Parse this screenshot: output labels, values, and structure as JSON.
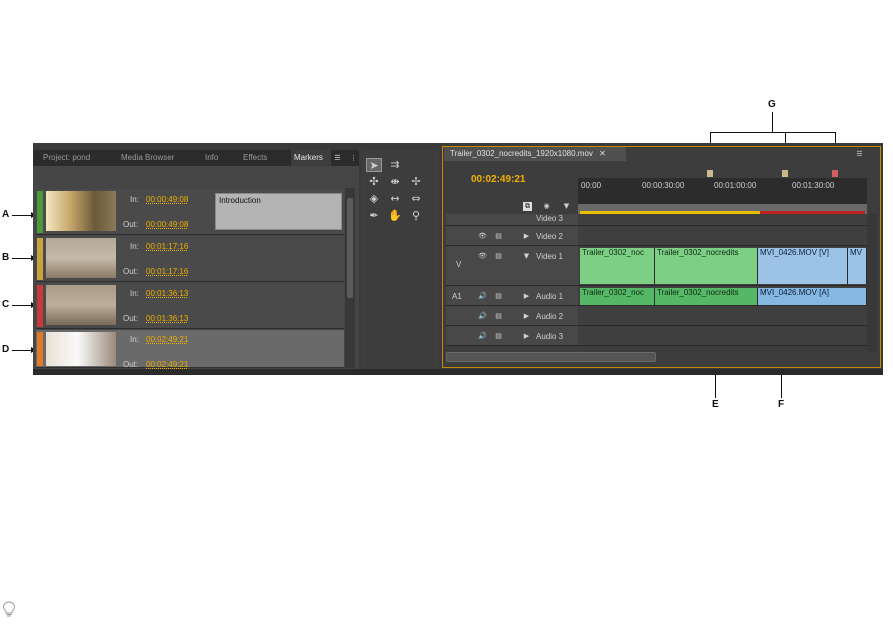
{
  "callouts": {
    "a": "A",
    "b": "B",
    "c": "C",
    "d": "D",
    "e": "E",
    "f": "F",
    "g": "G"
  },
  "tabs": [
    {
      "label": "Project: pond"
    },
    {
      "label": "Media Browser"
    },
    {
      "label": "Info"
    },
    {
      "label": "Effects"
    },
    {
      "label": "Markers"
    }
  ],
  "markers": {
    "in_label": "In:",
    "out_label": "Out:",
    "items": [
      {
        "color": "#4a9a3a",
        "in": "00:00:49:08",
        "out": "00:00:49:08",
        "note": "Introduction"
      },
      {
        "color": "#c9a23a",
        "in": "00:01:17:16",
        "out": "00:01:17:16",
        "note": ""
      },
      {
        "color": "#c83a3a",
        "in": "00:01:36:13",
        "out": "00:01:36:13",
        "note": ""
      },
      {
        "color": "#e07a2a",
        "in": "00:02:49:21",
        "out": "00:02:49:21",
        "note": ""
      }
    ]
  },
  "timeline": {
    "tab_title": "Trailer_0302_nocredits_1920x1080.mov",
    "timecode": "00:02:49:21",
    "ruler": [
      "00:00",
      "00:00:30:00",
      "00:01:00:00",
      "00:01:30:00"
    ],
    "source_video": "V",
    "source_audio": "A1",
    "tracks": {
      "video3": "Video 3",
      "video2": "Video 2",
      "video1": "Video 1",
      "audio1": "Audio 1",
      "audio2": "Audio 2",
      "audio3": "Audio 3"
    },
    "clips": {
      "v1_a": "Trailer_0302_noc",
      "v1_b": "Trailer_0302_nocredits",
      "v1_c": "MVI_0426.MOV [V]",
      "v1_d": "MV",
      "a1_a": "Trailer_0302_noc",
      "a1_b": "Trailer_0302_nocredits",
      "a1_c": "MVI_0426.MOV [A]"
    }
  },
  "colors": {
    "timecode": "#f0b000",
    "active_border": "#c58a00",
    "video_clip": "#7ecf86",
    "audio_clip": "#56b867",
    "linked_clip": "#9cc3e6"
  }
}
